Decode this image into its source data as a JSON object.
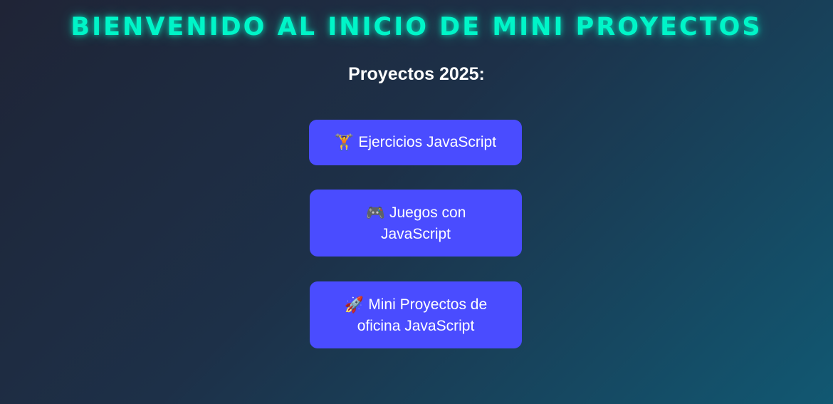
{
  "header": {
    "title": "BIENVENIDO AL INICIO DE MINI PROYECTOS",
    "subtitle": "Proyectos 2025:"
  },
  "projects": [
    {
      "icon": "weightlifter-icon",
      "glyph": "🏋",
      "label": "Ejercicios JavaScript"
    },
    {
      "icon": "gamepad-icon",
      "glyph": "🎮",
      "label": "Juegos con JavaScript"
    },
    {
      "icon": "rocket-icon",
      "glyph": "🚀",
      "label": "Mini Proyectos de oficina JavaScript"
    }
  ],
  "colors": {
    "title_glow": "#00f5c8",
    "button_bg": "#4a4cff",
    "bg_start": "#1f2436",
    "bg_end": "#115872"
  }
}
